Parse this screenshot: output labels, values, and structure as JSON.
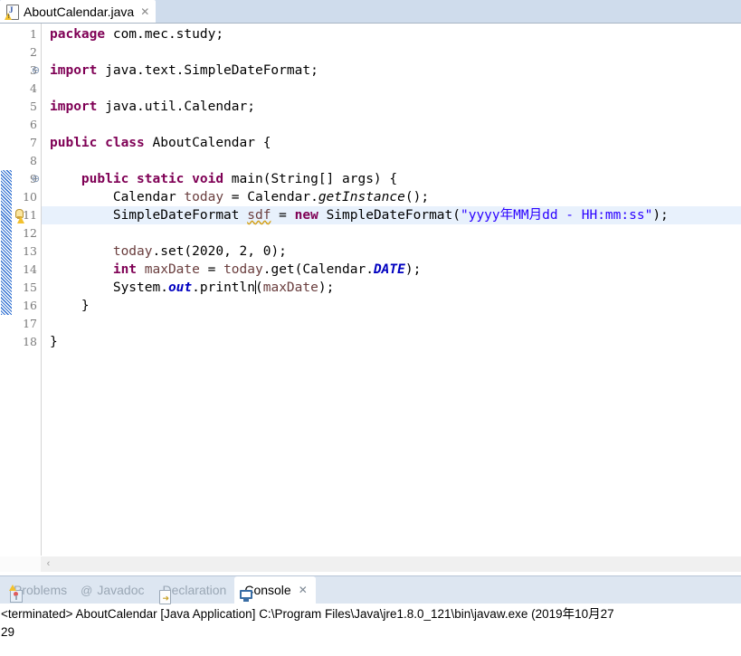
{
  "editor": {
    "tab": {
      "label": "AboutCalendar.java",
      "close": "✕",
      "icon": "java-file-warning-icon"
    },
    "gutter": {
      "fold_collapse_glyph": "⊖",
      "line_numbers": [
        1,
        2,
        3,
        4,
        5,
        6,
        7,
        8,
        9,
        10,
        11,
        12,
        13,
        14,
        15,
        16,
        17,
        18
      ],
      "fold_lines": [
        3,
        9
      ],
      "warning_line": 11,
      "changed_lines_from": 9,
      "changed_lines_to": 16,
      "highlighted_line": 11
    },
    "code_lines": [
      {
        "n": 1,
        "tokens": [
          {
            "t": "package ",
            "c": "kw"
          },
          {
            "t": "com.mec.study;",
            "c": ""
          }
        ]
      },
      {
        "n": 2,
        "tokens": []
      },
      {
        "n": 3,
        "tokens": [
          {
            "t": "import ",
            "c": "kw"
          },
          {
            "t": "java.text.SimpleDateFormat;",
            "c": ""
          }
        ]
      },
      {
        "n": 4,
        "tokens": []
      },
      {
        "n": 5,
        "tokens": [
          {
            "t": "import ",
            "c": "kw"
          },
          {
            "t": "java.util.Calendar;",
            "c": ""
          }
        ]
      },
      {
        "n": 6,
        "tokens": []
      },
      {
        "n": 7,
        "tokens": [
          {
            "t": "public ",
            "c": "kw"
          },
          {
            "t": "class ",
            "c": "kw"
          },
          {
            "t": "AboutCalendar {",
            "c": ""
          }
        ]
      },
      {
        "n": 8,
        "tokens": []
      },
      {
        "n": 9,
        "tokens": [
          {
            "t": "    ",
            "c": ""
          },
          {
            "t": "public ",
            "c": "kw"
          },
          {
            "t": "static ",
            "c": "kw"
          },
          {
            "t": "void ",
            "c": "kw"
          },
          {
            "t": "main(String[] args) {",
            "c": ""
          }
        ]
      },
      {
        "n": 10,
        "tokens": [
          {
            "t": "        Calendar ",
            "c": ""
          },
          {
            "t": "today",
            "c": "loc"
          },
          {
            "t": " = Calendar.",
            "c": ""
          },
          {
            "t": "getInstance",
            "c": "mth"
          },
          {
            "t": "();",
            "c": ""
          }
        ]
      },
      {
        "n": 11,
        "tokens": [
          {
            "t": "        SimpleDateFormat ",
            "c": ""
          },
          {
            "t": "sdf",
            "c": "loc warnword"
          },
          {
            "t": " = ",
            "c": ""
          },
          {
            "t": "new ",
            "c": "kw"
          },
          {
            "t": "SimpleDateFormat(",
            "c": ""
          },
          {
            "t": "\"yyyy年MM月dd - HH:mm:ss\"",
            "c": "str"
          },
          {
            "t": ");",
            "c": ""
          }
        ]
      },
      {
        "n": 12,
        "tokens": []
      },
      {
        "n": 13,
        "tokens": [
          {
            "t": "        ",
            "c": ""
          },
          {
            "t": "today",
            "c": "loc"
          },
          {
            "t": ".set(2020, 2, 0);",
            "c": ""
          }
        ]
      },
      {
        "n": 14,
        "tokens": [
          {
            "t": "        ",
            "c": ""
          },
          {
            "t": "int ",
            "c": "kw"
          },
          {
            "t": "maxDate",
            "c": "loc"
          },
          {
            "t": " = ",
            "c": ""
          },
          {
            "t": "today",
            "c": "loc"
          },
          {
            "t": ".get(Calendar.",
            "c": ""
          },
          {
            "t": "DATE",
            "c": "fld"
          },
          {
            "t": ");",
            "c": ""
          }
        ]
      },
      {
        "n": 15,
        "tokens": [
          {
            "t": "        System.",
            "c": ""
          },
          {
            "t": "out",
            "c": "fld"
          },
          {
            "t": ".println",
            "c": ""
          },
          {
            "t": "|",
            "c": "caret"
          },
          {
            "t": "(",
            "c": ""
          },
          {
            "t": "maxDate",
            "c": "loc"
          },
          {
            "t": ");",
            "c": ""
          }
        ]
      },
      {
        "n": 16,
        "tokens": [
          {
            "t": "    }",
            "c": ""
          }
        ]
      },
      {
        "n": 17,
        "tokens": []
      },
      {
        "n": 18,
        "tokens": [
          {
            "t": "}",
            "c": ""
          }
        ]
      }
    ],
    "scrollbar": {
      "left_arrow": "‹"
    }
  },
  "bottom_panel": {
    "tabs": [
      {
        "label": "Problems",
        "icon": "problems-icon",
        "active": false,
        "close": ""
      },
      {
        "label": "Javadoc",
        "icon": "at-icon",
        "active": false,
        "close": ""
      },
      {
        "label": "Declaration",
        "icon": "declaration-icon",
        "active": false,
        "close": ""
      },
      {
        "label": "Console",
        "icon": "console-icon",
        "active": true,
        "close": "✕"
      }
    ],
    "console": {
      "header": "<terminated> AboutCalendar [Java Application] C:\\Program Files\\Java\\jre1.8.0_121\\bin\\javaw.exe (2019年10月27",
      "output": "29"
    }
  },
  "colors": {
    "tabbar_bg": "#cfdcec",
    "panel_tab_bg": "#dde6f1",
    "keyword": "#7f0055",
    "string": "#2a00ff",
    "field": "#0000c0",
    "local_var": "#6a3e3e",
    "line_number": "#7a7a7a",
    "highlight_row": "#e8f1fc",
    "change_bar": "#2f6fd0",
    "warning_underline": "#d4a017"
  }
}
